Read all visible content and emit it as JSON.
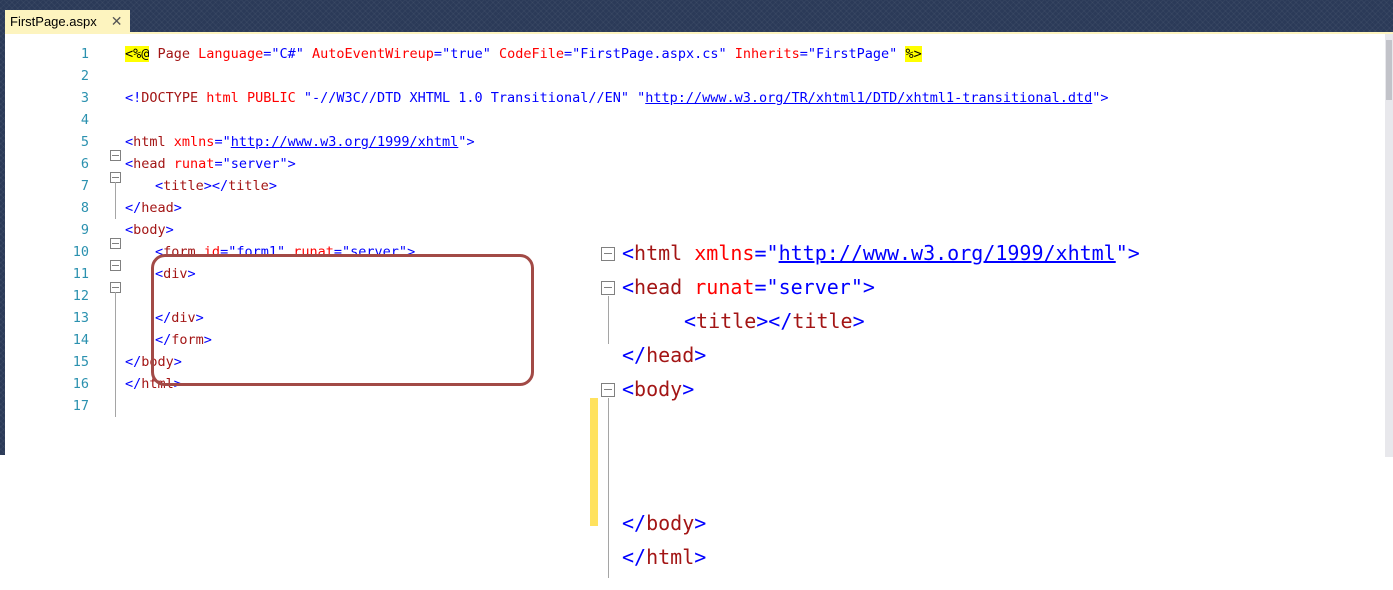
{
  "tab": {
    "title": "FirstPage.aspx",
    "close_glyph": "✕"
  },
  "editor": {
    "line_numbers": [
      "1",
      "2",
      "3",
      "4",
      "5",
      "6",
      "7",
      "8",
      "9",
      "10",
      "11",
      "12",
      "13",
      "14",
      "15",
      "16",
      "17"
    ],
    "lines": {
      "l1": {
        "open": "<%@",
        "a": " Page ",
        "attr1": "Language",
        "eq1": "=",
        "v1": "\"C#\"",
        "sp1": " ",
        "attr2": "AutoEventWireup",
        "eq2": "=",
        "v2": "\"true\"",
        "sp2": " ",
        "attr3": "CodeFile",
        "eq3": "=",
        "v3": "\"FirstPage.aspx.cs\"",
        "sp3": " ",
        "attr4": "Inherits",
        "eq4": "=",
        "v4": "\"FirstPage\"",
        "sp4": " ",
        "close": "%>"
      },
      "l3": {
        "open": "<!",
        "tag": "DOCTYPE",
        "rest1": " html ",
        "kw": "PUBLIC",
        "v1": " \"-//W3C//DTD XHTML 1.0 Transitional//EN\" ",
        "q1": "\"",
        "url": "http://www.w3.org/TR/xhtml1/DTD/xhtml1-transitional.dtd",
        "q2": "\"",
        "end": ">"
      },
      "l5": {
        "lt": "<",
        "tag": "html",
        "sp": " ",
        "attr": "xmlns",
        "eq": "=",
        "q1": "\"",
        "url": "http://www.w3.org/1999/xhtml",
        "q2": "\"",
        "gt": ">"
      },
      "l6": {
        "lt": "<",
        "tag": "head",
        "sp": " ",
        "attr": "runat",
        "eq": "=",
        "v": "\"server\"",
        "gt": ">"
      },
      "l7": {
        "lt1": "<",
        "tag1": "title",
        "gt1": "></",
        "tag2": "title",
        "gt2": ">"
      },
      "l8": {
        "lt": "</",
        "tag": "head",
        "gt": ">"
      },
      "l9": {
        "lt": "<",
        "tag": "body",
        "gt": ">"
      },
      "l10": {
        "lt": "<",
        "tag": "form",
        "sp1": " ",
        "attr1": "id",
        "eq1": "=",
        "v1": "\"form1\"",
        "sp2": " ",
        "attr2": "runat",
        "eq2": "=",
        "v2": "\"server\"",
        "gt": ">"
      },
      "l11": {
        "lt": "<",
        "tag": "div",
        "gt": ">"
      },
      "l13": {
        "lt": "</",
        "tag": "div",
        "gt": ">"
      },
      "l14": {
        "lt": "</",
        "tag": "form",
        "gt": ">"
      },
      "l15": {
        "lt": "</",
        "tag": "body",
        "gt": ">"
      },
      "l16": {
        "lt": "</",
        "tag": "html",
        "gt": ">"
      }
    }
  },
  "zoom": {
    "z1": {
      "lt": "<",
      "tag": "html",
      "sp": " ",
      "attr": "xmlns",
      "eq": "=",
      "q1": "\"",
      "url": "http://www.w3.org/1999/xhtml",
      "q2": "\"",
      "gt": ">"
    },
    "z2": {
      "lt": "<",
      "tag": "head",
      "sp": " ",
      "attr": "runat",
      "eq": "=",
      "v": "\"server\"",
      "gt": ">"
    },
    "z3": {
      "lt1": "<",
      "tag1": "title",
      "gt1": "></",
      "tag2": "title",
      "gt2": ">"
    },
    "z4": {
      "lt": "</",
      "tag": "head",
      "gt": ">"
    },
    "z5": {
      "lt": "<",
      "tag": "body",
      "gt": ">"
    },
    "z6": {
      "lt": "</",
      "tag": "body",
      "gt": ">"
    },
    "z7": {
      "lt": "</",
      "tag": "html",
      "gt": ">"
    }
  }
}
